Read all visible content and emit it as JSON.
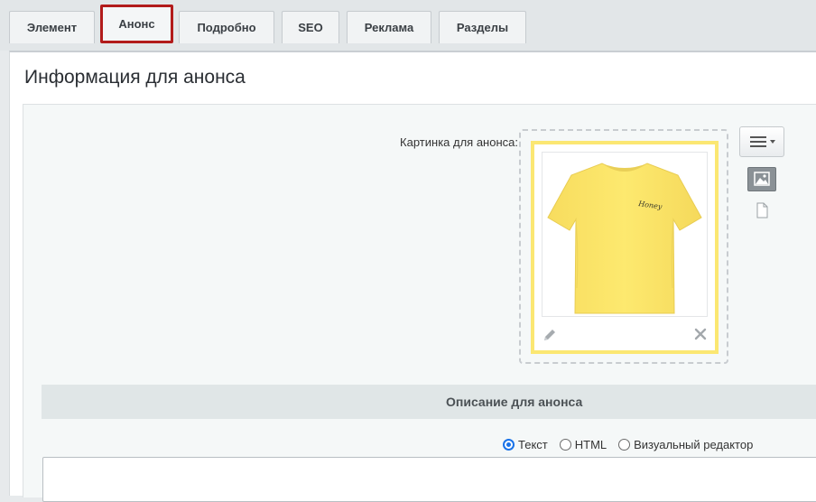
{
  "tabs": [
    {
      "label": "Элемент",
      "active": false
    },
    {
      "label": "Анонс",
      "active": true
    },
    {
      "label": "Подробно",
      "active": false
    },
    {
      "label": "SEO",
      "active": false
    },
    {
      "label": "Реклама",
      "active": false
    },
    {
      "label": "Разделы",
      "active": false
    }
  ],
  "panel": {
    "title": "Информация для анонса"
  },
  "preview_image": {
    "label": "Картинка для анонса:",
    "shirt_text": "Honey",
    "frame_color": "#fbe772",
    "shirt_color": "#fde96f",
    "icons": [
      "edit-icon",
      "delete-icon",
      "menu-icon",
      "image-mode-icon",
      "file-icon"
    ]
  },
  "description": {
    "header": "Описание для анонса",
    "modes": [
      {
        "label": "Текст",
        "checked": true
      },
      {
        "label": "HTML",
        "checked": false
      },
      {
        "label": "Визуальный редактор",
        "checked": false
      }
    ],
    "value": ""
  },
  "colors": {
    "active_tab_border": "#b21b1b",
    "radio_accent": "#1a73e8"
  }
}
